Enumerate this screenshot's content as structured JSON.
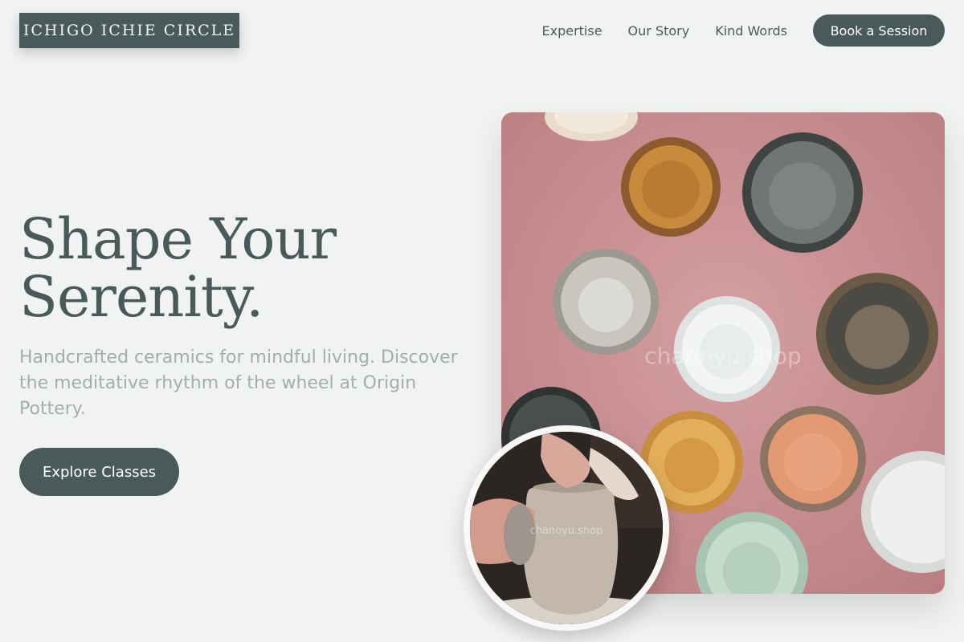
{
  "brand": {
    "name": "ICHIGO ICHIE CIRCLE"
  },
  "nav": {
    "items": [
      {
        "label": "Expertise"
      },
      {
        "label": "Our Story"
      },
      {
        "label": "Kind Words"
      }
    ],
    "cta_label": "Book a Session"
  },
  "hero": {
    "title_line1": "Shape Your",
    "title_line2": "Serenity.",
    "subtitle": "Handcrafted ceramics for mindful living. Discover the meditative rhythm of the wheel at Origin Pottery.",
    "button_label": "Explore Classes"
  },
  "images": {
    "main_watermark": "chanoyu.shop",
    "circle_watermark": "chanoyu.shop"
  },
  "colors": {
    "background": "#f1f3f2",
    "primary": "#4a5a5a",
    "muted_text": "#a3aeac",
    "photo_backdrop": "#c98f92"
  }
}
